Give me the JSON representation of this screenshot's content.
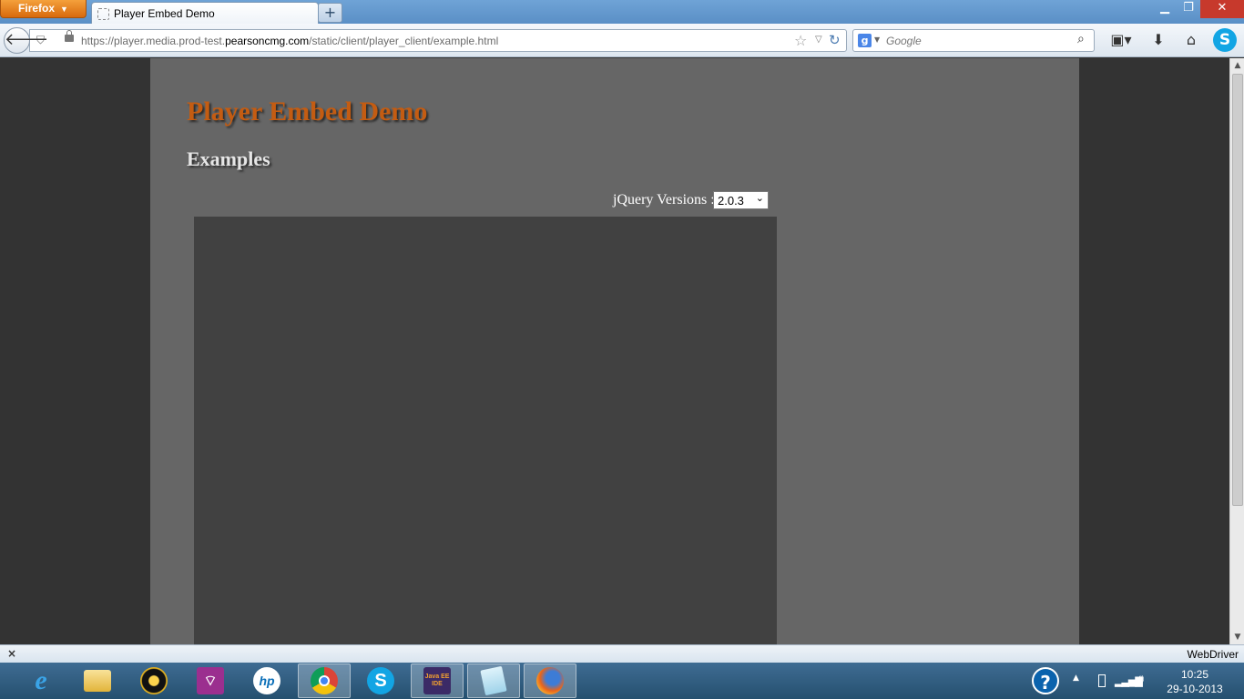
{
  "browser": {
    "menu_button": "Firefox",
    "tab_title": "Player Embed Demo",
    "new_tab": "+",
    "url_prefix": "https://player.media.prod-test.",
    "url_domain": "pearsoncmg.com",
    "url_path": "/static/client/player_client/example.html",
    "search_placeholder": "Google",
    "search_engine_letter": "g"
  },
  "page": {
    "title": "Player Embed Demo",
    "heading": "Examples",
    "jquery_label": "jQuery Versions :",
    "jquery_selected": "2.0.3",
    "title_color": "#c45c12"
  },
  "addon_bar": {
    "close": "×",
    "label": "WebDriver"
  },
  "taskbar": {
    "apps": [
      {
        "name": "internet-explorer",
        "glyph": "e"
      },
      {
        "name": "file-explorer",
        "glyph": ""
      },
      {
        "name": "media-player",
        "glyph": ""
      },
      {
        "name": "remote-connect",
        "glyph": ""
      },
      {
        "name": "hp",
        "glyph": "hp"
      },
      {
        "name": "chrome",
        "glyph": ""
      },
      {
        "name": "skype",
        "glyph": "S"
      },
      {
        "name": "java-ee-ide",
        "glyph": "Java EE IDE"
      },
      {
        "name": "notepad",
        "glyph": ""
      },
      {
        "name": "firefox",
        "glyph": ""
      }
    ],
    "time": "10:25",
    "date": "29-10-2013"
  }
}
